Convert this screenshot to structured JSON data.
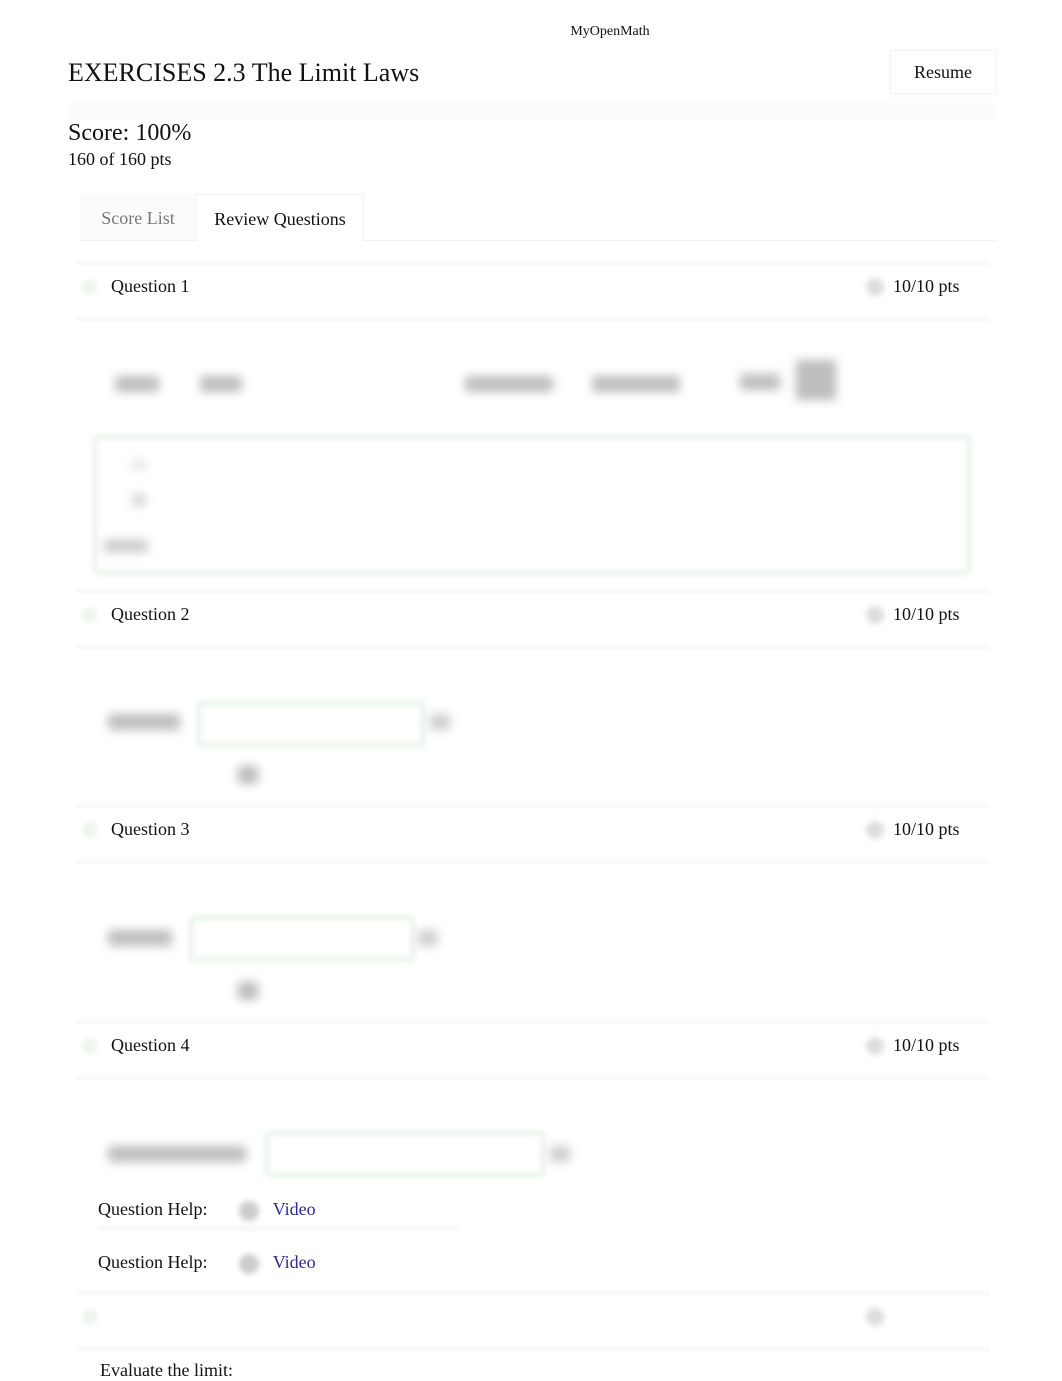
{
  "site": {
    "name": "MyOpenMath"
  },
  "header": {
    "title": "EXERCISES 2.3 The Limit Laws",
    "resume_label": "Resume"
  },
  "score": {
    "label": "Score: 100%",
    "points": "160 of 160 pts"
  },
  "tabs": [
    {
      "label": "Score List",
      "active": false
    },
    {
      "label": "Review Questions",
      "active": true
    }
  ],
  "questions": [
    {
      "title": "Question 1",
      "points": "10/10 pts",
      "status": "correct"
    },
    {
      "title": "Question 2",
      "points": "10/10 pts",
      "status": "correct"
    },
    {
      "title": "Question 3",
      "points": "10/10 pts",
      "status": "correct"
    },
    {
      "title": "Question 4",
      "points": "10/10 pts",
      "status": "correct"
    },
    {
      "title": "",
      "points": "",
      "status": "correct"
    }
  ],
  "question_help": [
    {
      "label": "Question Help:",
      "link": "Video"
    },
    {
      "label": "Question Help:",
      "link": "Video"
    }
  ],
  "next_question": {
    "prompt": "Evaluate the limit:"
  },
  "colors": {
    "correct_green": "#eef6ee",
    "link_blue": "#2a2aa0",
    "muted_tab": "#777777"
  }
}
